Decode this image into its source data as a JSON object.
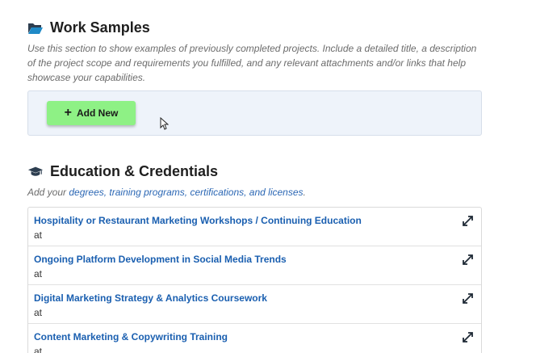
{
  "work_samples": {
    "title": "Work Samples",
    "icon": "folder-open-icon",
    "description": "Use this section to show examples of previously completed projects. Include a detailed title, a description of the project scope and requirements you fulfilled, and any relevant attachments and/or links that help showcase your capabilities.",
    "add_button_label": "Add New"
  },
  "education": {
    "title": "Education & Credentials",
    "icon": "graduation-cap-icon",
    "description_prefix": "Add your ",
    "description_link": "degrees, training programs, certifications, and licenses",
    "description_suffix": ".",
    "items": [
      {
        "title": "Hospitality or Restaurant Marketing Workshops / Continuing Education",
        "subtitle": "at"
      },
      {
        "title": "Ongoing Platform Development in Social Media Trends",
        "subtitle": "at"
      },
      {
        "title": "Digital Marketing Strategy & Analytics Coursework",
        "subtitle": "at"
      },
      {
        "title": "Content Marketing & Copywriting Training",
        "subtitle": "at"
      }
    ]
  },
  "colors": {
    "add_button_bg": "#8ef185",
    "link_blue": "#1a5fb0",
    "panel_bg": "#eef3fa"
  }
}
